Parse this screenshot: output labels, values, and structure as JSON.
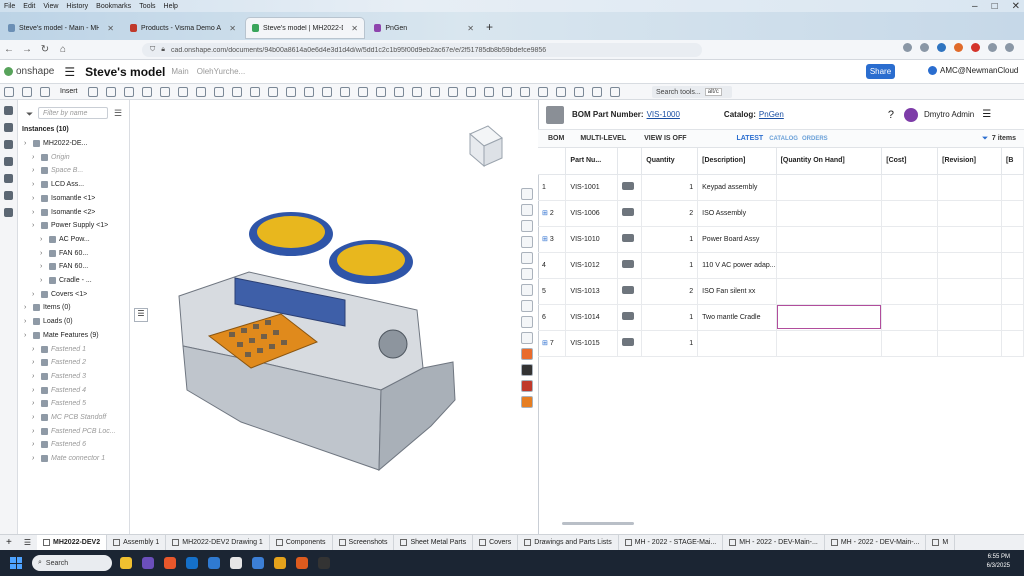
{
  "browser": {
    "menu": [
      "File",
      "Edit",
      "View",
      "History",
      "Bookmarks",
      "Tools",
      "Help"
    ],
    "tabs": [
      {
        "label": "Steve's model - Main - MH2022-DEV2 - C",
        "active": false
      },
      {
        "label": "Products - Visma Demo AS - B",
        "active": false
      },
      {
        "label": "Steve's model | MH2022-DEV2",
        "active": true
      },
      {
        "label": "PnGen",
        "active": false
      }
    ],
    "url": "cad.onshape.com/documents/94b00a8614a0e6d4e3d1d4d/w/5dd1c2c1b95f00d9eb2ac67e/e/2f51785db8b59bdefce9856"
  },
  "onshape": {
    "logo": "onshape",
    "doc_name": "Steve's model",
    "doc_branch": "Main",
    "owner": "OlehYurche...",
    "share_label": "Share",
    "user": "AMC@NewmanCloud",
    "insert_label": "Insert",
    "search_tools": "Search tools...",
    "search_shortcut": "alt/c"
  },
  "tree": {
    "filter_placeholder": "Filter by name",
    "instances_header": "Instances (10)",
    "items": [
      {
        "label": "MH2022-DE...",
        "dim": false,
        "level": 0
      },
      {
        "label": "Origin",
        "dim": true,
        "level": 1
      },
      {
        "label": "Space B...",
        "dim": true,
        "level": 1
      },
      {
        "label": "LCD Ass...",
        "dim": false,
        "level": 1
      },
      {
        "label": "Isomantle <1>",
        "dim": false,
        "level": 1
      },
      {
        "label": "Isomantle <2>",
        "dim": false,
        "level": 1
      },
      {
        "label": "Power Supply <1>",
        "dim": false,
        "level": 1
      },
      {
        "label": "AC Pow...",
        "dim": false,
        "level": 2
      },
      {
        "label": "FAN 60...",
        "dim": false,
        "level": 2
      },
      {
        "label": "FAN 60...",
        "dim": false,
        "level": 2
      },
      {
        "label": "Cradle - ...",
        "dim": false,
        "level": 2
      },
      {
        "label": "Covers <1>",
        "dim": false,
        "level": 1
      },
      {
        "label": "Items (0)",
        "dim": false,
        "level": 0
      },
      {
        "label": "Loads (0)",
        "dim": false,
        "level": 0
      },
      {
        "label": "Mate Features (9)",
        "dim": false,
        "level": 0
      },
      {
        "label": "Fastened 1",
        "dim": true,
        "level": 1
      },
      {
        "label": "Fastened 2",
        "dim": true,
        "level": 1
      },
      {
        "label": "Fastened 3",
        "dim": true,
        "level": 1
      },
      {
        "label": "Fastened 4",
        "dim": true,
        "level": 1
      },
      {
        "label": "Fastened 5",
        "dim": true,
        "level": 1
      },
      {
        "label": "MC PCB Standoff",
        "dim": true,
        "level": 1
      },
      {
        "label": "Fastened PCB Loc...",
        "dim": true,
        "level": 1
      },
      {
        "label": "Fastened 6",
        "dim": true,
        "level": 1
      },
      {
        "label": "Mate connector 1",
        "dim": true,
        "level": 1
      }
    ]
  },
  "bom": {
    "part_number_label": "BOM Part Number:",
    "part_number": "VIS-1000",
    "catalog_label": "Catalog:",
    "catalog": "PnGen",
    "user": "Dmytro Admin",
    "toolbar": {
      "bom": "BOM",
      "multilevel": "MULTI-LEVEL",
      "view": "VIEW IS OFF",
      "latest": "LATEST",
      "catalog": "CATALOG",
      "orders": "ORDERS",
      "count": "7 items"
    },
    "columns": [
      "Part Nu...",
      "",
      "Quantity",
      "[Description]",
      "[Quantity On Hand]",
      "[Cost]",
      "[Revision]",
      "[B"
    ],
    "rows": [
      {
        "index": "1",
        "part": "VIS-1001",
        "qty": "1",
        "desc": "Keypad assembly",
        "expand": false
      },
      {
        "index": "2",
        "part": "VIS-1006",
        "qty": "2",
        "desc": "ISO Assembly",
        "expand": true
      },
      {
        "index": "3",
        "part": "VIS-1010",
        "qty": "1",
        "desc": "Power Board Assy",
        "expand": true
      },
      {
        "index": "4",
        "part": "VIS-1012",
        "qty": "1",
        "desc": "110 V AC power adap...",
        "expand": false
      },
      {
        "index": "5",
        "part": "VIS-1013",
        "qty": "2",
        "desc": "ISO Fan silent xx",
        "expand": false
      },
      {
        "index": "6",
        "part": "VIS-1014",
        "qty": "1",
        "desc": "Two mantle Cradle",
        "expand": false
      },
      {
        "index": "7",
        "part": "VIS-1015",
        "qty": "1",
        "desc": "",
        "expand": true
      }
    ]
  },
  "bottom_tabs": [
    {
      "label": "MH2022-DEV2",
      "active": true
    },
    {
      "label": "Assembly 1",
      "active": false
    },
    {
      "label": "MH2022-DEV2 Drawing 1",
      "active": false
    },
    {
      "label": "Components",
      "active": false
    },
    {
      "label": "Screenshots",
      "active": false
    },
    {
      "label": "Sheet Metal Parts",
      "active": false
    },
    {
      "label": "Covers",
      "active": false
    },
    {
      "label": "Drawings and Parts Lists",
      "active": false
    },
    {
      "label": "MH - 2022 - STAGE-Mai...",
      "active": false
    },
    {
      "label": "MH - 2022 - DEV-Main-...",
      "active": false
    },
    {
      "label": "MH - 2022 - DEV-Main-...",
      "active": false
    },
    {
      "label": "M",
      "active": false
    }
  ],
  "taskbar": {
    "search": "Search",
    "time": "6:55 PM",
    "date": "6/3/2025"
  },
  "colors": {
    "accent": "#2a6dcf",
    "selection": "#b14d9c",
    "taskbar": "#1b2533"
  }
}
